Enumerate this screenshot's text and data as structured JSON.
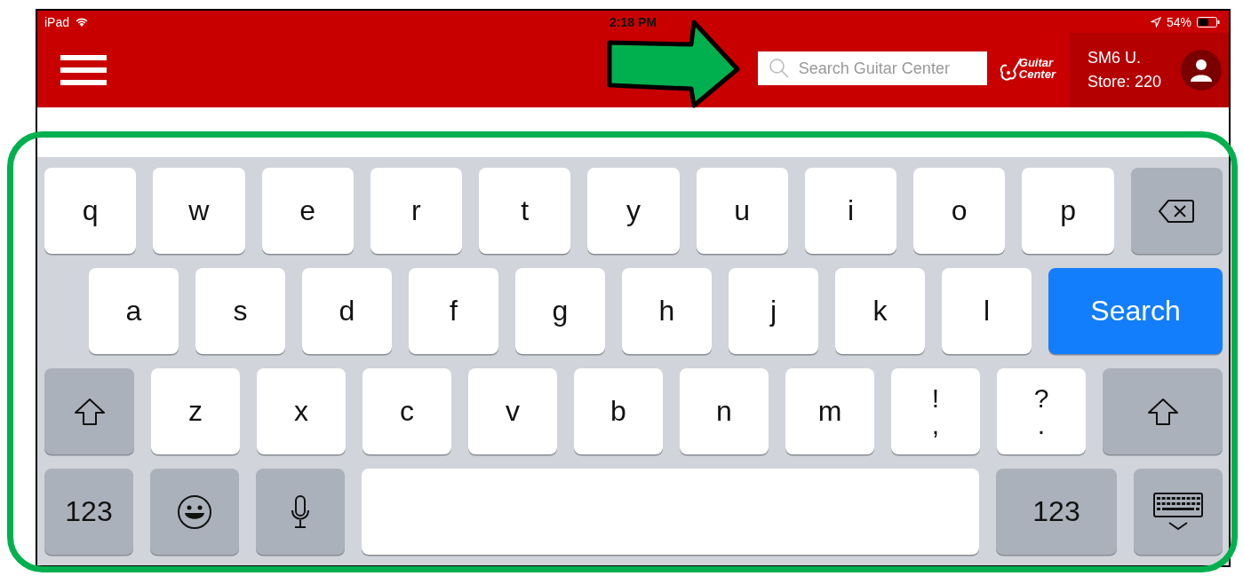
{
  "status_bar": {
    "carrier": "iPad",
    "time": "2:18 PM",
    "battery": "54%"
  },
  "header": {
    "search": {
      "placeholder": "Search Guitar Center"
    },
    "logo": [
      "Guitar",
      "Center"
    ],
    "user": {
      "name": "SM6 U.",
      "store": "Store: 220"
    }
  },
  "keyboard": {
    "rows": [
      {
        "keys": [
          {
            "kind": "letter",
            "label": "q"
          },
          {
            "kind": "letter",
            "label": "w"
          },
          {
            "kind": "letter",
            "label": "e"
          },
          {
            "kind": "letter",
            "label": "r"
          },
          {
            "kind": "letter",
            "label": "t"
          },
          {
            "kind": "letter",
            "label": "y"
          },
          {
            "kind": "letter",
            "label": "u"
          },
          {
            "kind": "letter",
            "label": "i"
          },
          {
            "kind": "letter",
            "label": "o"
          },
          {
            "kind": "letter",
            "label": "p"
          },
          {
            "kind": "backspace"
          }
        ]
      },
      {
        "keys": [
          {
            "kind": "letter",
            "label": "a"
          },
          {
            "kind": "letter",
            "label": "s"
          },
          {
            "kind": "letter",
            "label": "d"
          },
          {
            "kind": "letter",
            "label": "f"
          },
          {
            "kind": "letter",
            "label": "g"
          },
          {
            "kind": "letter",
            "label": "h"
          },
          {
            "kind": "letter",
            "label": "j"
          },
          {
            "kind": "letter",
            "label": "k"
          },
          {
            "kind": "letter",
            "label": "l"
          },
          {
            "kind": "action",
            "label": "Search"
          }
        ]
      },
      {
        "keys": [
          {
            "kind": "shift"
          },
          {
            "kind": "letter",
            "label": "z"
          },
          {
            "kind": "letter",
            "label": "x"
          },
          {
            "kind": "letter",
            "label": "c"
          },
          {
            "kind": "letter",
            "label": "v"
          },
          {
            "kind": "letter",
            "label": "b"
          },
          {
            "kind": "letter",
            "label": "n"
          },
          {
            "kind": "letter",
            "label": "m"
          },
          {
            "kind": "dual",
            "top": "!",
            "bottom": ","
          },
          {
            "kind": "dual",
            "top": "?",
            "bottom": "."
          },
          {
            "kind": "shift"
          }
        ]
      },
      {
        "keys": [
          {
            "kind": "mode",
            "label": "123"
          },
          {
            "kind": "emoji"
          },
          {
            "kind": "mic"
          },
          {
            "kind": "space"
          },
          {
            "kind": "mode",
            "label": "123"
          },
          {
            "kind": "dismiss"
          }
        ]
      }
    ]
  }
}
